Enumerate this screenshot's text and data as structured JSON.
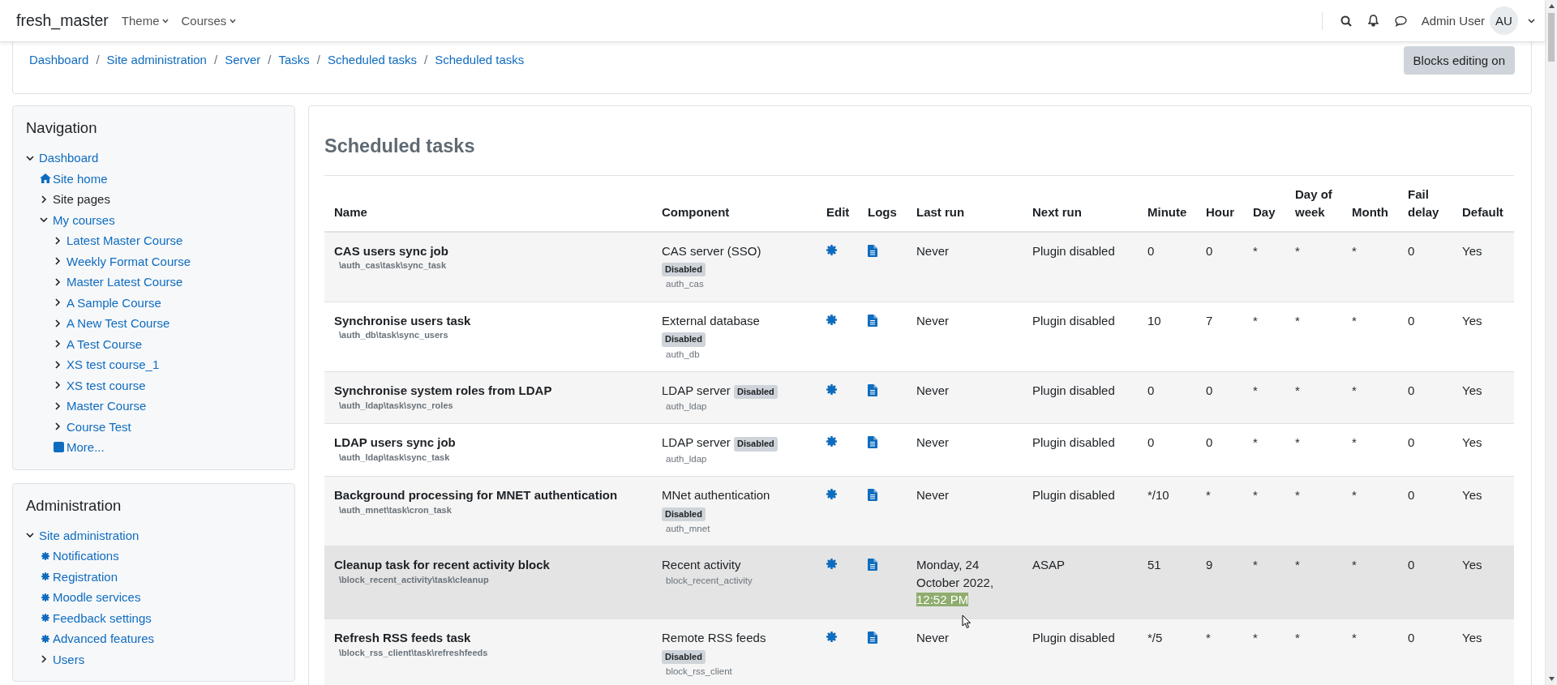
{
  "navbar": {
    "brand": "fresh_master",
    "menus": [
      {
        "label": "Theme"
      },
      {
        "label": "Courses"
      }
    ],
    "user": {
      "name": "Admin User",
      "initials": "AU"
    }
  },
  "breadcrumb": {
    "separator": "/",
    "items": [
      "Dashboard",
      "Site administration",
      "Server",
      "Tasks",
      "Scheduled tasks",
      "Scheduled tasks"
    ]
  },
  "edit_button": "Blocks editing on",
  "navigation": {
    "title": "Navigation",
    "items": [
      {
        "label": "Dashboard",
        "kind": "branch",
        "expanded": true,
        "link": true,
        "children": [
          {
            "label": "Site home",
            "kind": "home",
            "link": true
          },
          {
            "label": "Site pages",
            "kind": "branch",
            "expanded": false,
            "link": false
          },
          {
            "label": "My courses",
            "kind": "branch",
            "expanded": true,
            "link": true,
            "children": [
              {
                "label": "Latest Master Course",
                "kind": "branch",
                "expanded": false,
                "link": true
              },
              {
                "label": "Weekly Format Course",
                "kind": "branch",
                "expanded": false,
                "link": true
              },
              {
                "label": "Master Latest Course",
                "kind": "branch",
                "expanded": false,
                "link": true
              },
              {
                "label": "A Sample Course",
                "kind": "branch",
                "expanded": false,
                "link": true
              },
              {
                "label": "A New Test Course",
                "kind": "branch",
                "expanded": false,
                "link": true
              },
              {
                "label": "A Test Course",
                "kind": "branch",
                "expanded": false,
                "link": true
              },
              {
                "label": "XS test course_1",
                "kind": "branch",
                "expanded": false,
                "link": true
              },
              {
                "label": "XS test course",
                "kind": "branch",
                "expanded": false,
                "link": true
              },
              {
                "label": "Master Course",
                "kind": "branch",
                "expanded": false,
                "link": true
              },
              {
                "label": "Course Test",
                "kind": "branch",
                "expanded": false,
                "link": true
              },
              {
                "label": "More...",
                "kind": "more",
                "link": true
              }
            ]
          }
        ]
      }
    ]
  },
  "administration": {
    "title": "Administration",
    "items": [
      {
        "label": "Site administration",
        "kind": "branch",
        "expanded": true,
        "link": true,
        "children": [
          {
            "label": "Notifications",
            "kind": "setting",
            "link": true
          },
          {
            "label": "Registration",
            "kind": "setting",
            "link": true
          },
          {
            "label": "Moodle services",
            "kind": "setting",
            "link": true
          },
          {
            "label": "Feedback settings",
            "kind": "setting",
            "link": true
          },
          {
            "label": "Advanced features",
            "kind": "setting",
            "link": true
          },
          {
            "label": "Users",
            "kind": "branch",
            "expanded": false,
            "link": true
          }
        ]
      }
    ]
  },
  "page_title": "Scheduled tasks",
  "table": {
    "columns": [
      "Name",
      "Component",
      "Edit",
      "Logs",
      "Last run",
      "Next run",
      "Minute",
      "Hour",
      "Day",
      "Day of week",
      "Month",
      "Fail delay",
      "Default"
    ],
    "rows": [
      {
        "name": "CAS users sync job",
        "classname": "\\auth_cas\\task\\sync_task",
        "component": "CAS server (SSO)",
        "badge": "Disabled",
        "plugin": "auth_cas",
        "last_run": "Never",
        "next_run": "Plugin disabled",
        "minute": "0",
        "hour": "0",
        "day": "*",
        "day_of_week": "*",
        "month": "*",
        "fail_delay": "0",
        "default": "Yes",
        "hovered": false
      },
      {
        "name": "Synchronise users task",
        "classname": "\\auth_db\\task\\sync_users",
        "component": "External database",
        "badge": "Disabled",
        "plugin": "auth_db",
        "last_run": "Never",
        "next_run": "Plugin disabled",
        "minute": "10",
        "hour": "7",
        "day": "*",
        "day_of_week": "*",
        "month": "*",
        "fail_delay": "0",
        "default": "Yes",
        "hovered": false
      },
      {
        "name": "Synchronise system roles from LDAP",
        "classname": "\\auth_ldap\\task\\sync_roles",
        "component": "LDAP server",
        "badge": "Disabled",
        "plugin": "auth_ldap",
        "last_run": "Never",
        "next_run": "Plugin disabled",
        "minute": "0",
        "hour": "0",
        "day": "*",
        "day_of_week": "*",
        "month": "*",
        "fail_delay": "0",
        "default": "Yes",
        "hovered": false
      },
      {
        "name": "LDAP users sync job",
        "classname": "\\auth_ldap\\task\\sync_task",
        "component": "LDAP server",
        "badge": "Disabled",
        "plugin": "auth_ldap",
        "last_run": "Never",
        "next_run": "Plugin disabled",
        "minute": "0",
        "hour": "0",
        "day": "*",
        "day_of_week": "*",
        "month": "*",
        "fail_delay": "0",
        "default": "Yes",
        "hovered": false
      },
      {
        "name": "Background processing for MNET authentication",
        "classname": "\\auth_mnet\\task\\cron_task",
        "component": "MNet authentication",
        "badge": "Disabled",
        "plugin": "auth_mnet",
        "last_run": "Never",
        "next_run": "Plugin disabled",
        "minute": "*/10",
        "hour": "*",
        "day": "*",
        "day_of_week": "*",
        "month": "*",
        "fail_delay": "0",
        "default": "Yes",
        "hovered": false
      },
      {
        "name": "Cleanup task for recent activity block",
        "classname": "\\block_recent_activity\\task\\cleanup",
        "component": "Recent activity",
        "plugin": "block_recent_activity",
        "last_run": "Monday, 24 October 2022,",
        "last_run_selected": "12:52 PM",
        "next_run": "ASAP",
        "minute": "51",
        "hour": "9",
        "day": "*",
        "day_of_week": "*",
        "month": "*",
        "fail_delay": "0",
        "default": "Yes",
        "hovered": true
      },
      {
        "name": "Refresh RSS feeds task",
        "classname": "\\block_rss_client\\task\\refreshfeeds",
        "component": "Remote RSS feeds",
        "badge": "Disabled",
        "plugin": "block_rss_client",
        "last_run": "Never",
        "next_run": "Plugin disabled",
        "minute": "*/5",
        "hour": "*",
        "day": "*",
        "day_of_week": "*",
        "month": "*",
        "fail_delay": "0",
        "default": "Yes",
        "hovered": false
      }
    ]
  }
}
